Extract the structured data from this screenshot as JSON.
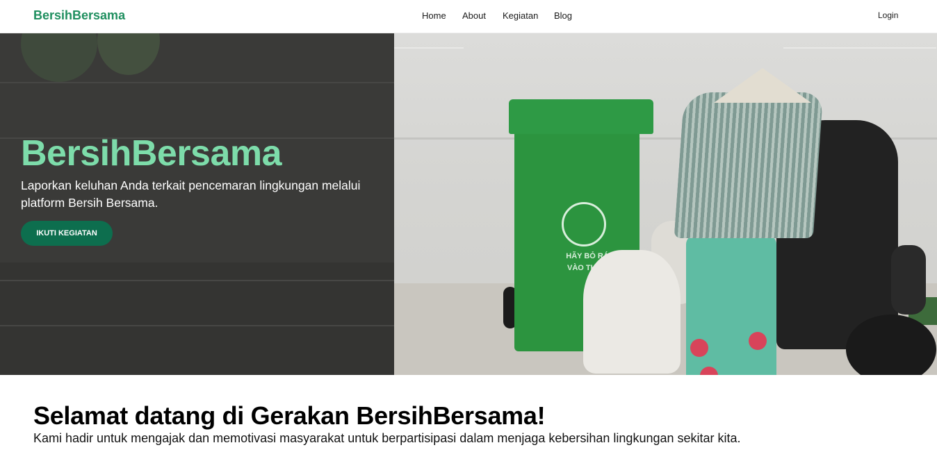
{
  "navbar": {
    "brand": "BersihBersama",
    "links": [
      {
        "label": "Home"
      },
      {
        "label": "About"
      },
      {
        "label": "Kegiatan"
      },
      {
        "label": "Blog"
      }
    ],
    "login_label": "Login"
  },
  "hero": {
    "title": "BersihBersama",
    "subtitle": "Laporkan keluhan Anda terkait pencemaran lingkungan melalui platform Bersih Bersama.",
    "cta_label": "IKUTI KEGIATAN",
    "photo": {
      "bin_text": "HÃY BỎ RÁC VÀO THÙNG"
    }
  },
  "welcome": {
    "title": "Selamat datang di Gerakan BersihBersama!",
    "text": "Kami hadir untuk mengajak dan memotivasi masyarakat untuk berpartisipasi dalam menjaga kebersihan lingkungan sekitar kita."
  },
  "colors": {
    "brand": "#1f8f5f",
    "hero_title": "#7ddcaa",
    "cta": "#0d6e4e"
  }
}
